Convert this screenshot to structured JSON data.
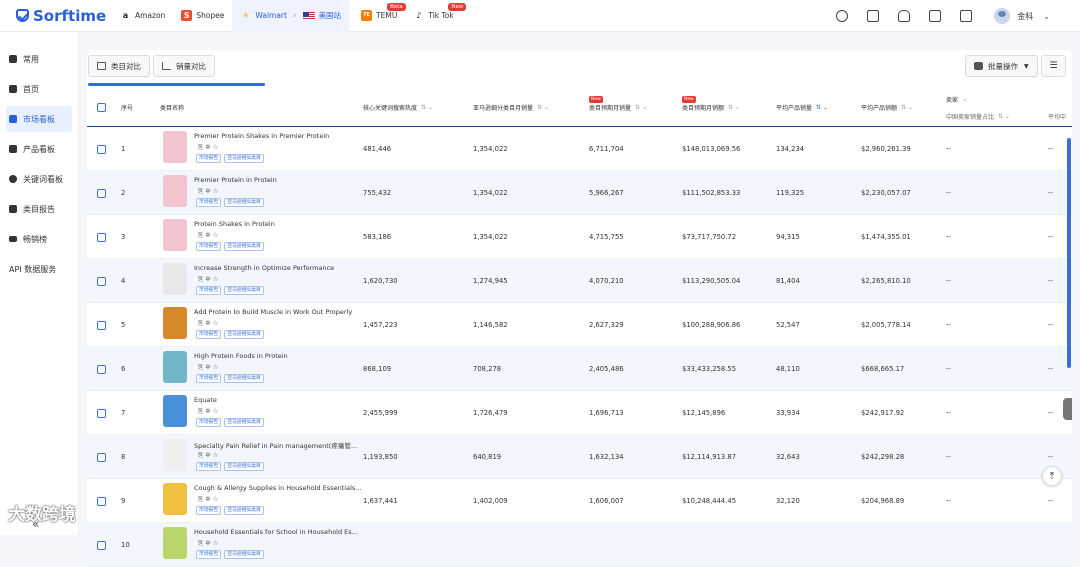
{
  "brand": "Sorftime",
  "platform_tabs": [
    {
      "label": "Amazon",
      "icon": "amazon-icon"
    },
    {
      "label": "Shopee",
      "icon": "shopee-icon"
    },
    {
      "label": "Walmart",
      "icon": "walmart-icon",
      "active": true
    },
    {
      "label": "美国站",
      "icon": "us-flag-icon"
    },
    {
      "label": "TEMU",
      "icon": "temu-icon",
      "badge": "Beta"
    },
    {
      "label": "Tik Tok",
      "icon": "tiktok-icon",
      "badge": "New"
    }
  ],
  "user": {
    "name": "金科"
  },
  "sidebar": {
    "items": [
      {
        "label": "常用",
        "icon": "pin-icon"
      },
      {
        "label": "首页",
        "icon": "home-icon"
      },
      {
        "label": "市场看板",
        "icon": "market-board-icon",
        "active": true
      },
      {
        "label": "产品看板",
        "icon": "product-board-icon"
      },
      {
        "label": "关键词看板",
        "icon": "keyword-board-icon"
      },
      {
        "label": "类目报告",
        "icon": "report-icon"
      },
      {
        "label": "畅销榜",
        "icon": "bestseller-icon"
      },
      {
        "label": "API 数据服务",
        "icon": ""
      }
    ]
  },
  "toolbar": {
    "compare_category": "类目对比",
    "compare_sales": "销量对比",
    "batch_ops": "批量操作"
  },
  "table": {
    "headers": {
      "index": "序号",
      "name": "类目名称",
      "keyword_heat": "核心关键词搜索热度",
      "amazon_monthly": "亚马逊细分类目月销量",
      "est_monthly_sales": "类目预期月销量",
      "est_monthly_revenue": "类目预期月销额",
      "avg_sales": "平均产品销量",
      "avg_revenue": "平均产品销额",
      "seller": "卖家",
      "cn_seller_share": "中国卖家销量占比",
      "avg_cut": "平均中"
    },
    "new_badge": "New",
    "tag_market": "市场报告",
    "tag_amazon": "亚马逊相似类目",
    "rows": [
      {
        "idx": "1",
        "name": "Premier Protein Shakes in Premier Protein",
        "heat": "481,446",
        "amz": "1,354,022",
        "sales": "6,711,704",
        "rev": "$148,013,069.56",
        "avg_sales": "134,234",
        "avg_rev": "$2,960,261.39",
        "cn": "--",
        "x": "--"
      },
      {
        "idx": "2",
        "name": "Premier Protein in Protein",
        "heat": "755,432",
        "amz": "1,354,022",
        "sales": "5,966,267",
        "rev": "$111,502,853.33",
        "avg_sales": "119,325",
        "avg_rev": "$2,230,057.07",
        "cn": "--",
        "x": "--"
      },
      {
        "idx": "3",
        "name": "Protein Shakes in Protein",
        "heat": "583,186",
        "amz": "1,354,022",
        "sales": "4,715,755",
        "rev": "$73,717,750.72",
        "avg_sales": "94,315",
        "avg_rev": "$1,474,355.01",
        "cn": "--",
        "x": "--"
      },
      {
        "idx": "4",
        "name": "Increase Strength in Optimize Performance",
        "heat": "1,620,730",
        "amz": "1,274,945",
        "sales": "4,070,210",
        "rev": "$113,290,505.04",
        "avg_sales": "81,404",
        "avg_rev": "$2,265,810.10",
        "cn": "--",
        "x": "--"
      },
      {
        "idx": "5",
        "name": "Add Protein to Build Muscle in Work Out Properly",
        "heat": "1,457,223",
        "amz": "1,146,582",
        "sales": "2,627,329",
        "rev": "$100,288,906.86",
        "avg_sales": "52,547",
        "avg_rev": "$2,005,778.14",
        "cn": "--",
        "x": "--"
      },
      {
        "idx": "6",
        "name": "High Protein Foods in Protein",
        "heat": "868,109",
        "amz": "708,278",
        "sales": "2,405,486",
        "rev": "$33,433,258.55",
        "avg_sales": "48,110",
        "avg_rev": "$668,665.17",
        "cn": "--",
        "x": "--"
      },
      {
        "idx": "7",
        "name": "Equate",
        "heat": "2,455,999",
        "amz": "1,726,479",
        "sales": "1,696,713",
        "rev": "$12,145,896",
        "avg_sales": "33,934",
        "avg_rev": "$242,917.92",
        "cn": "--",
        "x": "--"
      },
      {
        "idx": "8",
        "name": "Specialty Pain Relief in Pain management(疼痛管...",
        "heat": "1,193,850",
        "amz": "640,819",
        "sales": "1,632,134",
        "rev": "$12,114,913.87",
        "avg_sales": "32,643",
        "avg_rev": "$242,298.28",
        "cn": "--",
        "x": "--"
      },
      {
        "idx": "9",
        "name": "Cough & Allergy Supplies in Household Essentials...",
        "heat": "1,637,441",
        "amz": "1,402,009",
        "sales": "1,606,007",
        "rev": "$10,248,444.45",
        "avg_sales": "32,120",
        "avg_rev": "$204,968.89",
        "cn": "--",
        "x": "--"
      },
      {
        "idx": "10",
        "name": "Household Essentials for School in Household Es...",
        "heat": "",
        "amz": "",
        "sales": "",
        "rev": "",
        "avg_sales": "",
        "avg_rev": "",
        "cn": "",
        "x": ""
      }
    ]
  },
  "watermark": "大数跨境"
}
